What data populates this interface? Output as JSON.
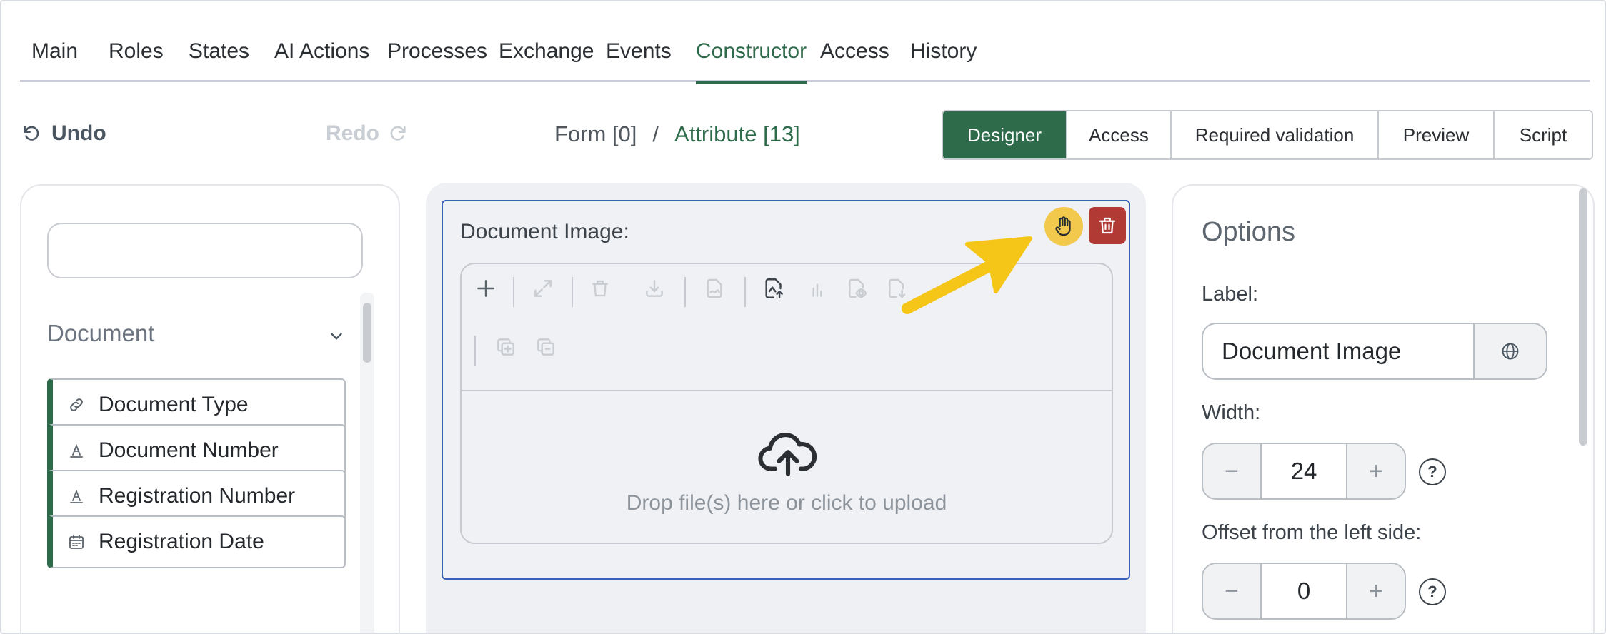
{
  "tabs": [
    {
      "label": "Main"
    },
    {
      "label": "Roles"
    },
    {
      "label": "States"
    },
    {
      "label": "AI Actions"
    },
    {
      "label": "Processes"
    },
    {
      "label": "Exchange"
    },
    {
      "label": "Events"
    },
    {
      "label": "Constructor"
    },
    {
      "label": "Access"
    },
    {
      "label": "History"
    }
  ],
  "active_tab": "Constructor",
  "toolbar": {
    "undo_label": "Undo",
    "redo_label": "Redo"
  },
  "breadcrumb": {
    "form": "Form [0]",
    "separator": "/",
    "attribute": "Attribute [13]"
  },
  "modes": [
    {
      "label": "Designer"
    },
    {
      "label": "Access"
    },
    {
      "label": "Required validation"
    },
    {
      "label": "Preview"
    },
    {
      "label": "Script"
    }
  ],
  "active_mode": "Designer",
  "left_panel": {
    "search_value": "",
    "group_title": "Document",
    "items": [
      {
        "label": "Document Type",
        "icon": "link-icon"
      },
      {
        "label": "Document Number",
        "icon": "text-icon"
      },
      {
        "label": "Registration Number",
        "icon": "text-icon"
      },
      {
        "label": "Registration Date",
        "icon": "calendar-icon"
      }
    ]
  },
  "widget": {
    "label": "Document Image:",
    "drop_text": "Drop file(s) here or click to upload"
  },
  "options": {
    "title": "Options",
    "label_caption": "Label:",
    "label_value": "Document Image",
    "width_caption": "Width:",
    "width_value": "24",
    "offset_caption": "Offset from the left side:",
    "offset_value": "0",
    "minus": "−",
    "plus": "+",
    "help": "?"
  },
  "colors": {
    "accent": "#2e6b4b",
    "highlight": "#f2c94c",
    "danger": "#b23a35",
    "arrow": "#f5c518"
  }
}
